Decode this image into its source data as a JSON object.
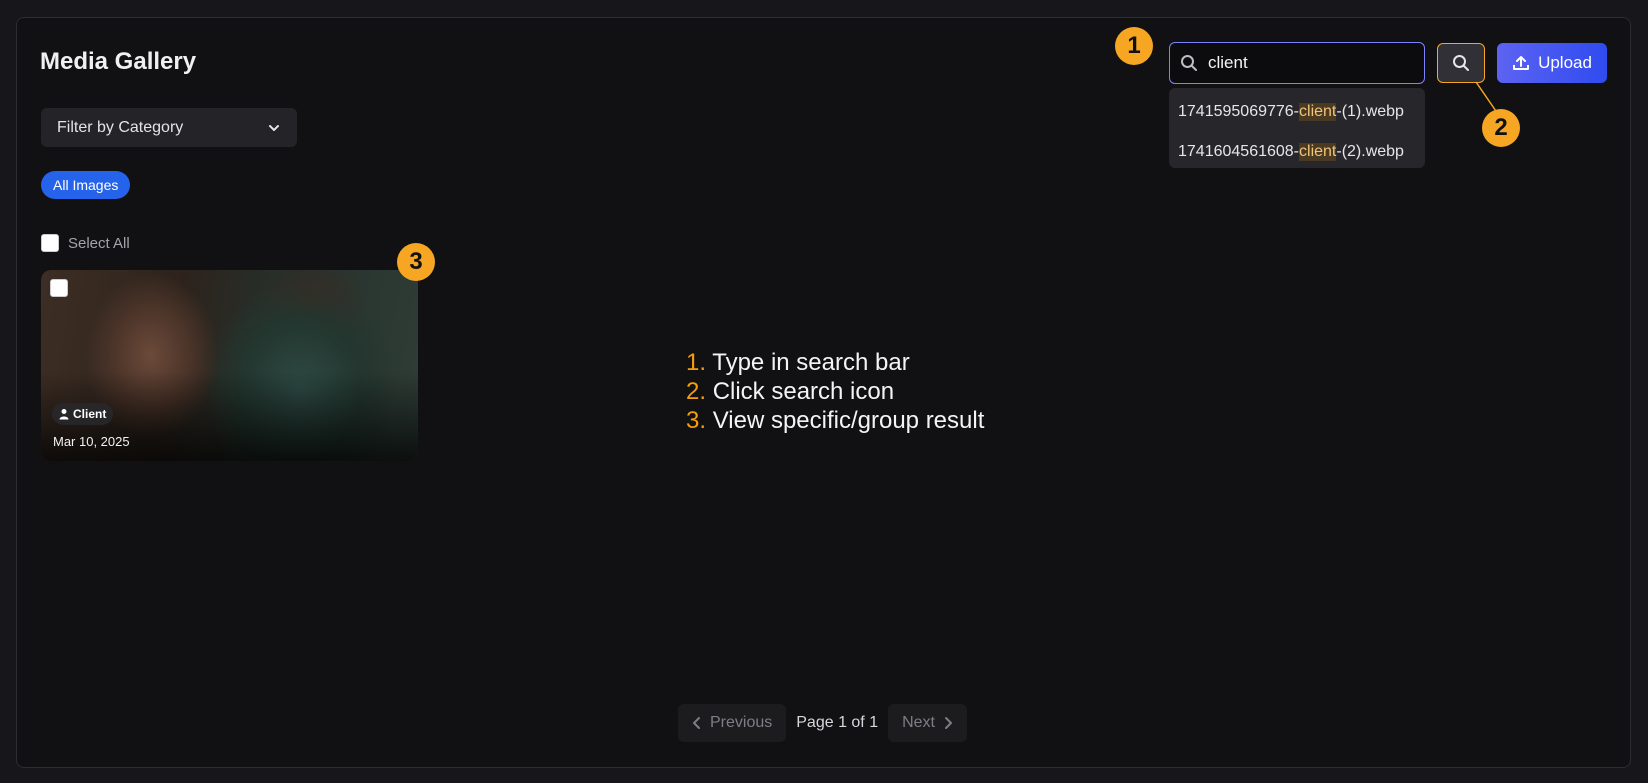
{
  "header": {
    "title": "Media Gallery"
  },
  "filter": {
    "label": "Filter by Category"
  },
  "categories": {
    "active_pill": "All Images"
  },
  "selection": {
    "select_all_label": "Select All"
  },
  "gallery": {
    "items": [
      {
        "category": "Client",
        "date": "Mar 10, 2025"
      }
    ]
  },
  "search": {
    "value": "client",
    "suggestions": [
      {
        "prefix": "1741595069776-",
        "match": "client",
        "suffix": "-(1).webp"
      },
      {
        "prefix": "1741604561608-",
        "match": "client",
        "suffix": "-(2).webp"
      }
    ]
  },
  "toolbar": {
    "upload_label": "Upload"
  },
  "instructions": {
    "steps": [
      {
        "number": "1.",
        "text": "Type in search bar"
      },
      {
        "number": "2.",
        "text": "Click search icon"
      },
      {
        "number": "3.",
        "text": "View specific/group result"
      }
    ]
  },
  "markers": {
    "one": "1",
    "two": "2",
    "three": "3"
  },
  "pagination": {
    "previous": "Previous",
    "page_text": "Page 1 of 1",
    "next": "Next"
  },
  "colors": {
    "accent": "#f6a623",
    "primary": "#2563eb",
    "upload_gradient_start": "#5d63f2",
    "upload_gradient_end": "#2f4bf0"
  }
}
